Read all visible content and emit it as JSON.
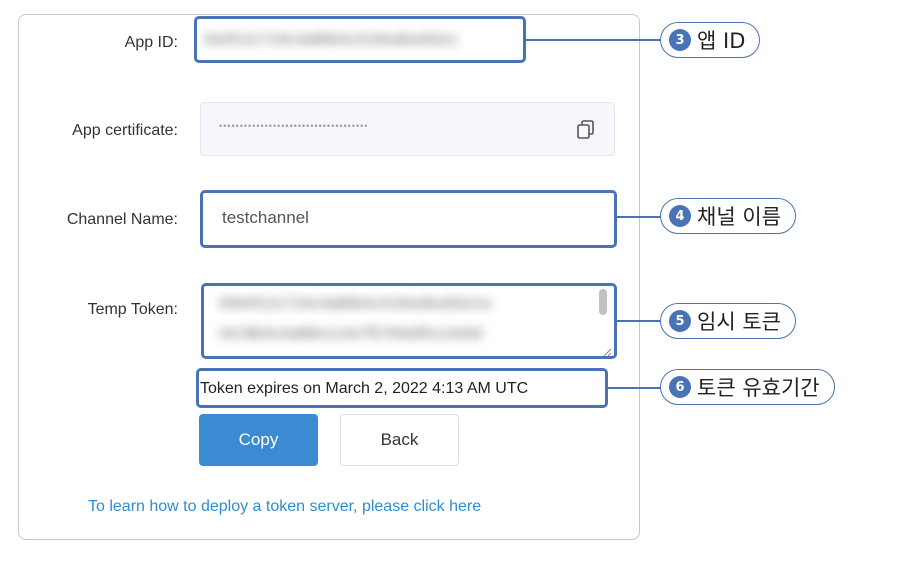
{
  "form": {
    "app_id_label": "App ID:",
    "app_cert_label": "App certificate:",
    "app_cert_value": "••••••••••••••••••••••••••••••••••••",
    "channel_label": "Channel Name:",
    "channel_value": "testchannel",
    "token_label": "Temp Token:",
    "expires_text": "Token expires on March 2, 2022 4:13 AM UTC",
    "copy_label": "Copy",
    "back_label": "Back",
    "learn_link": "To learn how to deploy a token server, please click here"
  },
  "callouts": [
    {
      "num": "3",
      "text": "앱 ID"
    },
    {
      "num": "4",
      "text": "채널 이름"
    },
    {
      "num": "5",
      "text": "임시 토큰"
    },
    {
      "num": "6",
      "text": "토큰 유효기간"
    }
  ],
  "colors": {
    "accent": "#4a73b5",
    "primary_button": "#3a8bd1",
    "link": "#2f8dd0"
  },
  "icons": {
    "copy": "copy-icon"
  }
}
